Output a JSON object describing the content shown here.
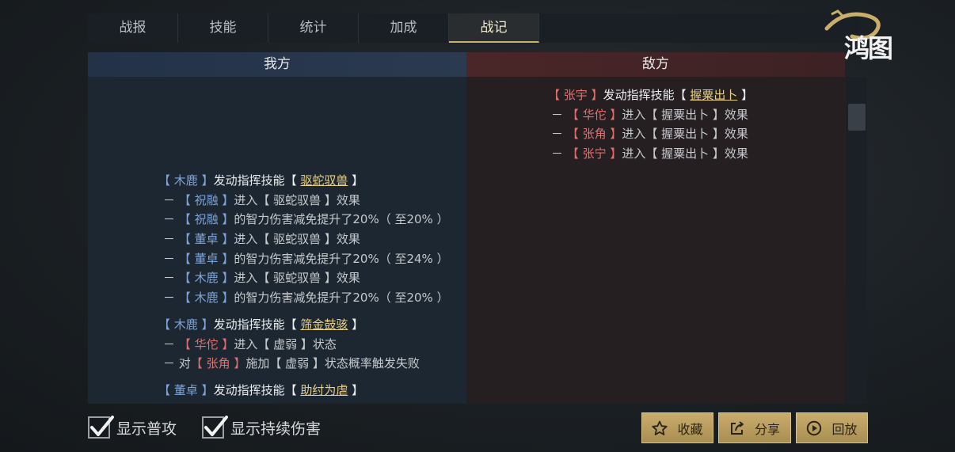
{
  "tabs": [
    "战报",
    "技能",
    "统计",
    "加成",
    "战记"
  ],
  "active_tab": "战记",
  "logo_text": "鸿图",
  "headers": {
    "my": "我方",
    "enemy": "敌方"
  },
  "enemy_log": {
    "actor": "张宇",
    "verb": "发动指挥技能",
    "skill": "握粟出卜",
    "lines": [
      {
        "name": "华佗",
        "text": "进入【 握粟出卜 】效果"
      },
      {
        "name": "张角",
        "text": "进入【 握粟出卜 】效果"
      },
      {
        "name": "张宁",
        "text": "进入【 握粟出卜 】效果"
      }
    ]
  },
  "my_log": {
    "group1": {
      "actor": "木鹿",
      "verb": "发动指挥技能",
      "skill": "驱蛇驭兽",
      "lines": [
        {
          "name": "祝融",
          "text": "进入【 驱蛇驭兽 】效果"
        },
        {
          "name": "祝融",
          "text": "的智力伤害减免提升了20%（ 至20% ）"
        },
        {
          "name": "董卓",
          "text": "进入【 驱蛇驭兽 】效果"
        },
        {
          "name": "董卓",
          "text": "的智力伤害减免提升了20%（ 至24% ）"
        },
        {
          "name": "木鹿",
          "text": "进入【 驱蛇驭兽 】效果"
        },
        {
          "name": "木鹿",
          "text": "的智力伤害减免提升了20%（ 至20% ）"
        }
      ]
    },
    "group2": {
      "actor": "木鹿",
      "verb": "发动指挥技能",
      "skill": "筛金鼓骇",
      "line1": {
        "name": "华佗",
        "text": "进入【 虚弱 】状态"
      },
      "line2": {
        "prefix": "－ 对",
        "name": "张角",
        "text": "施加【 虚弱 】状态概率触发失败"
      }
    },
    "group3": {
      "actor": "董卓",
      "verb": "发动指挥技能",
      "skill": "助纣为虐"
    }
  },
  "checkboxes": [
    {
      "label": "显示普攻",
      "checked": true
    },
    {
      "label": "显示持续伤害",
      "checked": true
    }
  ],
  "buttons": {
    "favorite": "收藏",
    "share": "分享",
    "replay": "回放"
  },
  "colors": {
    "accent_gold": "#c8ae6a",
    "ally_name": "#7ea4d8",
    "enemy_name": "#e07070",
    "skill": "#e8cf87"
  }
}
